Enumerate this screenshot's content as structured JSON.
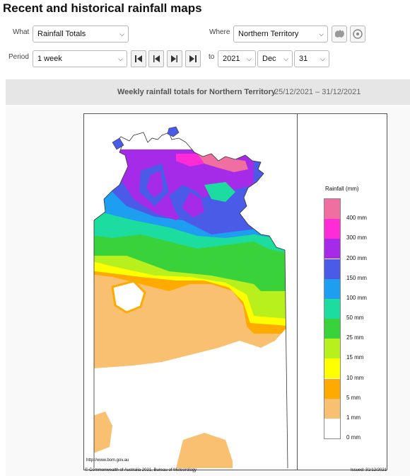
{
  "page_title": "Recent and historical rainfall maps",
  "controls": {
    "what_label": "What",
    "what_value": "Rainfall Totals",
    "where_label": "Where",
    "where_value": "Northern Territory",
    "period_label": "Period",
    "period_value": "1 week",
    "to_label": "to",
    "year_value": "2021",
    "month_value": "Dec",
    "day_value": "31",
    "nav_icons": [
      "skip-to-first-icon",
      "step-back-icon",
      "step-forward-icon",
      "skip-to-last-icon"
    ],
    "where_icons": [
      "australia-map-icon",
      "location-pin-icon"
    ]
  },
  "banner": {
    "title": "Weekly rainfall totals for Northern Territory",
    "date_range": "25/12/2021 – 31/12/2021"
  },
  "map": {
    "url_text": "http://www.bom.gov.au",
    "copyright": "© Commonwealth of Australia 2021, Bureau of Meteorology",
    "issued": "Issued: 31/12/2021"
  },
  "legend": {
    "title": "Rainfall (mm)",
    "labels": [
      "400 mm",
      "300 mm",
      "200 mm",
      "150 mm",
      "100 mm",
      "50 mm",
      "25 mm",
      "15 mm",
      "10 mm",
      "5 mm",
      "1 mm",
      "0 mm"
    ],
    "colors": [
      "#f06ea0",
      "#ff2bd6",
      "#a52be8",
      "#4a5be8",
      "#1e9ef0",
      "#1cdca0",
      "#3ad23a",
      "#b8f01e",
      "#ffff00",
      "#ffaa00",
      "#f8c070",
      "#ffffff"
    ]
  }
}
